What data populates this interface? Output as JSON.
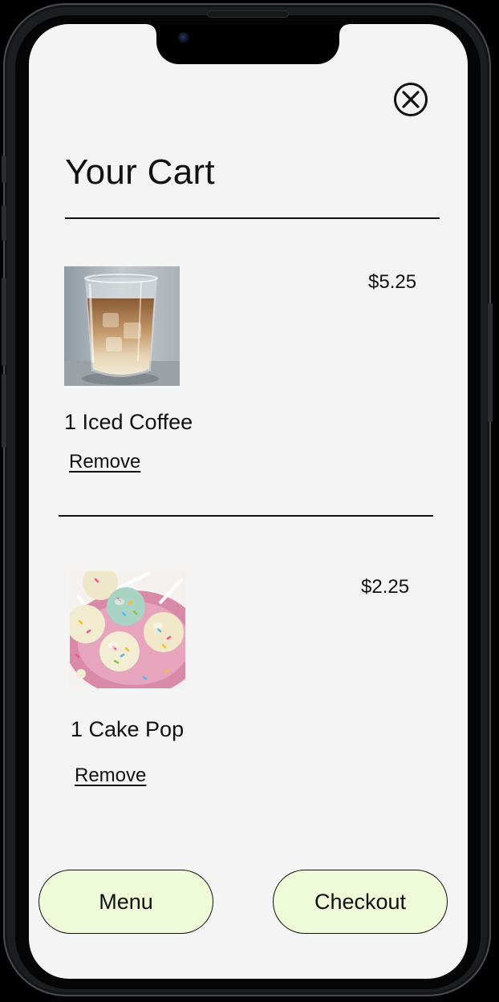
{
  "cart": {
    "title": "Your Cart",
    "close_icon": "close-circle-icon",
    "items": [
      {
        "name": "1 Iced Coffee",
        "price": "$5.25",
        "remove_label": "Remove",
        "image_subject": "iced-coffee-photo"
      },
      {
        "name": "1 Cake Pop",
        "price": "$2.25",
        "remove_label": "Remove",
        "image_subject": "cake-pops-photo"
      }
    ]
  },
  "footer": {
    "menu_label": "Menu",
    "checkout_label": "Checkout"
  },
  "colors": {
    "screen_background": "#f4f4f4",
    "button_fill": "#eefad8",
    "text": "#111111",
    "device_frame": "#1c1d1f"
  }
}
